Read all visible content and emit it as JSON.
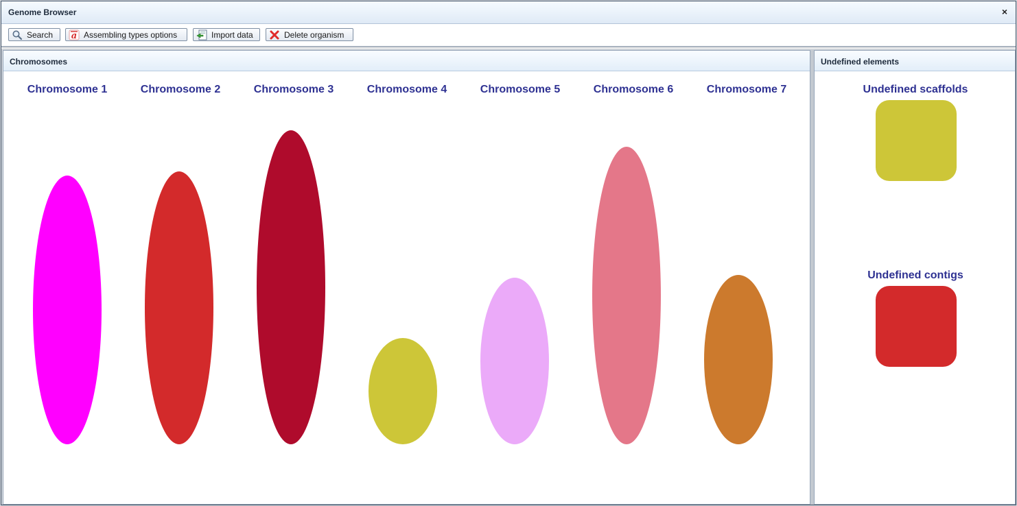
{
  "window": {
    "title": "Genome Browser",
    "close_glyph": "×"
  },
  "toolbar": {
    "search_label": "Search",
    "assembling_label": "Assembling types options",
    "import_label": "Import data",
    "delete_label": "Delete organism"
  },
  "chromosomes_panel": {
    "title": "Chromosomes",
    "items": [
      {
        "label": "Chromosome 1",
        "color": "#ff00ff"
      },
      {
        "label": "Chromosome 2",
        "color": "#d32a2b"
      },
      {
        "label": "Chromosome 3",
        "color": "#af0b2c"
      },
      {
        "label": "Chromosome 4",
        "color": "#cdc638"
      },
      {
        "label": "Chromosome 5",
        "color": "#ebaaf9"
      },
      {
        "label": "Chromosome 6",
        "color": "#e47789"
      },
      {
        "label": "Chromosome 7",
        "color": "#cc7a2d"
      }
    ]
  },
  "undefined_panel": {
    "title": "Undefined elements",
    "items": [
      {
        "label": "Undefined scaffolds",
        "color": "#cdc638"
      },
      {
        "label": "Undefined contigs",
        "color": "#d32a2b"
      }
    ]
  }
}
